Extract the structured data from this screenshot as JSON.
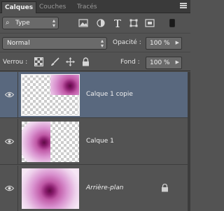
{
  "tabs": [
    {
      "label": "Calques",
      "active": true
    },
    {
      "label": "Couches",
      "active": false
    },
    {
      "label": "Tracés",
      "active": false
    }
  ],
  "filter": {
    "kind_value": "Type"
  },
  "blend": {
    "mode": "Normal",
    "opacity_label": "Opacité :",
    "opacity_value": "100 %"
  },
  "lock": {
    "label": "Verrou :",
    "fill_label": "Fond :",
    "fill_value": "100 %"
  },
  "layers": [
    {
      "name": "Calque 1 copie",
      "selected": true,
      "visible": true
    },
    {
      "name": "Calque 1",
      "selected": false,
      "visible": true
    },
    {
      "name": "Arrière-plan",
      "selected": false,
      "visible": true,
      "locked": true
    }
  ],
  "colors": {
    "panel": "#535353",
    "selected": "#59687e",
    "tabbar": "#3a3a3a"
  }
}
